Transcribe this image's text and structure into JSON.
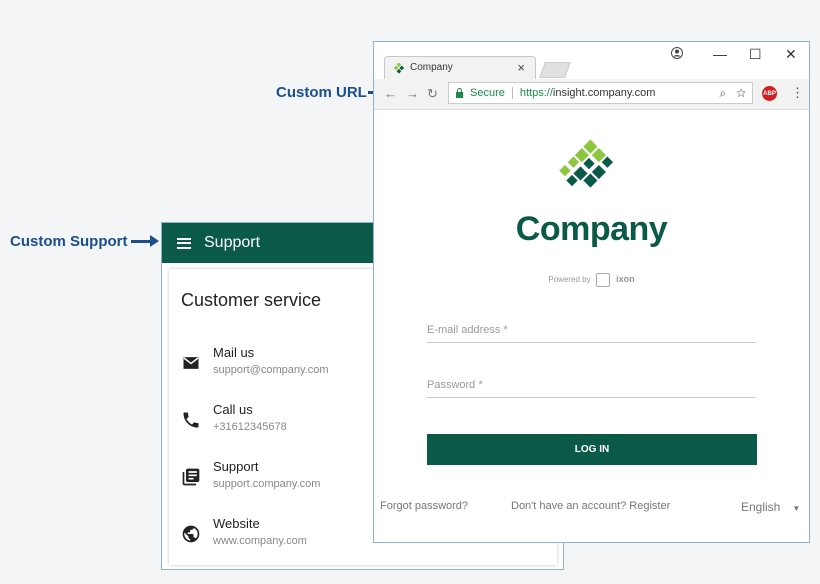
{
  "callouts": {
    "custom_url": "Custom URL",
    "custom_support": "Custom Support"
  },
  "support": {
    "header_title": "Support",
    "card_title": "Customer service",
    "contacts": [
      {
        "icon": "mail-icon",
        "label": "Mail us",
        "value": "support@company.com"
      },
      {
        "icon": "phone-icon",
        "label": "Call us",
        "value": "+31612345678"
      },
      {
        "icon": "document-icon",
        "label": "Support",
        "value": "support.company.com"
      },
      {
        "icon": "globe-icon",
        "label": "Website",
        "value": "www.company.com"
      }
    ]
  },
  "browser": {
    "tab_title": "Company",
    "tab_close": "×",
    "secure_label": "Secure",
    "url_protocol": "https://",
    "url_host": "insight.company.com",
    "abp_label": "ABP"
  },
  "login_page": {
    "brand_name": "Company",
    "powered_by": "Powered by",
    "powered_brand": "ixon",
    "email_placeholder": "E-mail address *",
    "password_placeholder": "Password *",
    "login_button": "LOG IN",
    "forgot_password": "Forgot password?",
    "register": "Don't have an account? Register",
    "language": "English"
  },
  "colors": {
    "brand_green": "#0a5a47",
    "logo_light_green": "#8cc63f",
    "callout_blue": "#1a4f8b"
  }
}
